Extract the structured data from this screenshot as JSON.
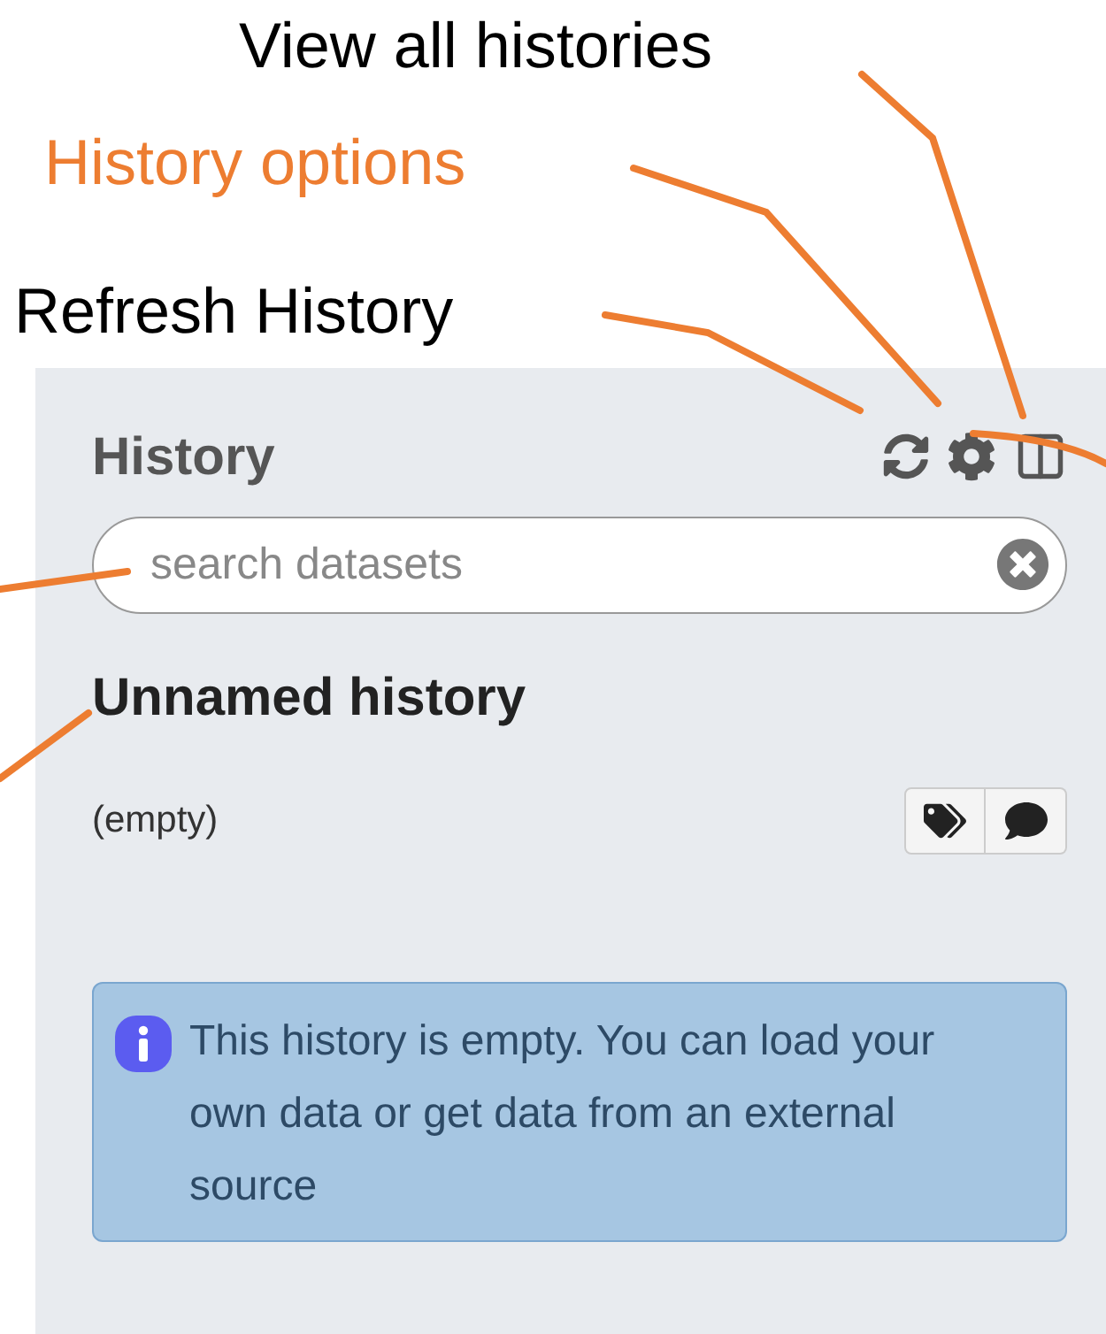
{
  "callouts": [
    {
      "text": "View all histories",
      "color": "#000000"
    },
    {
      "text": "History options",
      "color": "#ed7d31"
    },
    {
      "text": "Refresh History",
      "color": "#000000"
    }
  ],
  "panel": {
    "title": "History",
    "search": {
      "placeholder": "search datasets"
    },
    "history_name": "Unnamed history",
    "size": "(empty)",
    "message": "This history is empty. You can load your own data or get data from an external source"
  }
}
